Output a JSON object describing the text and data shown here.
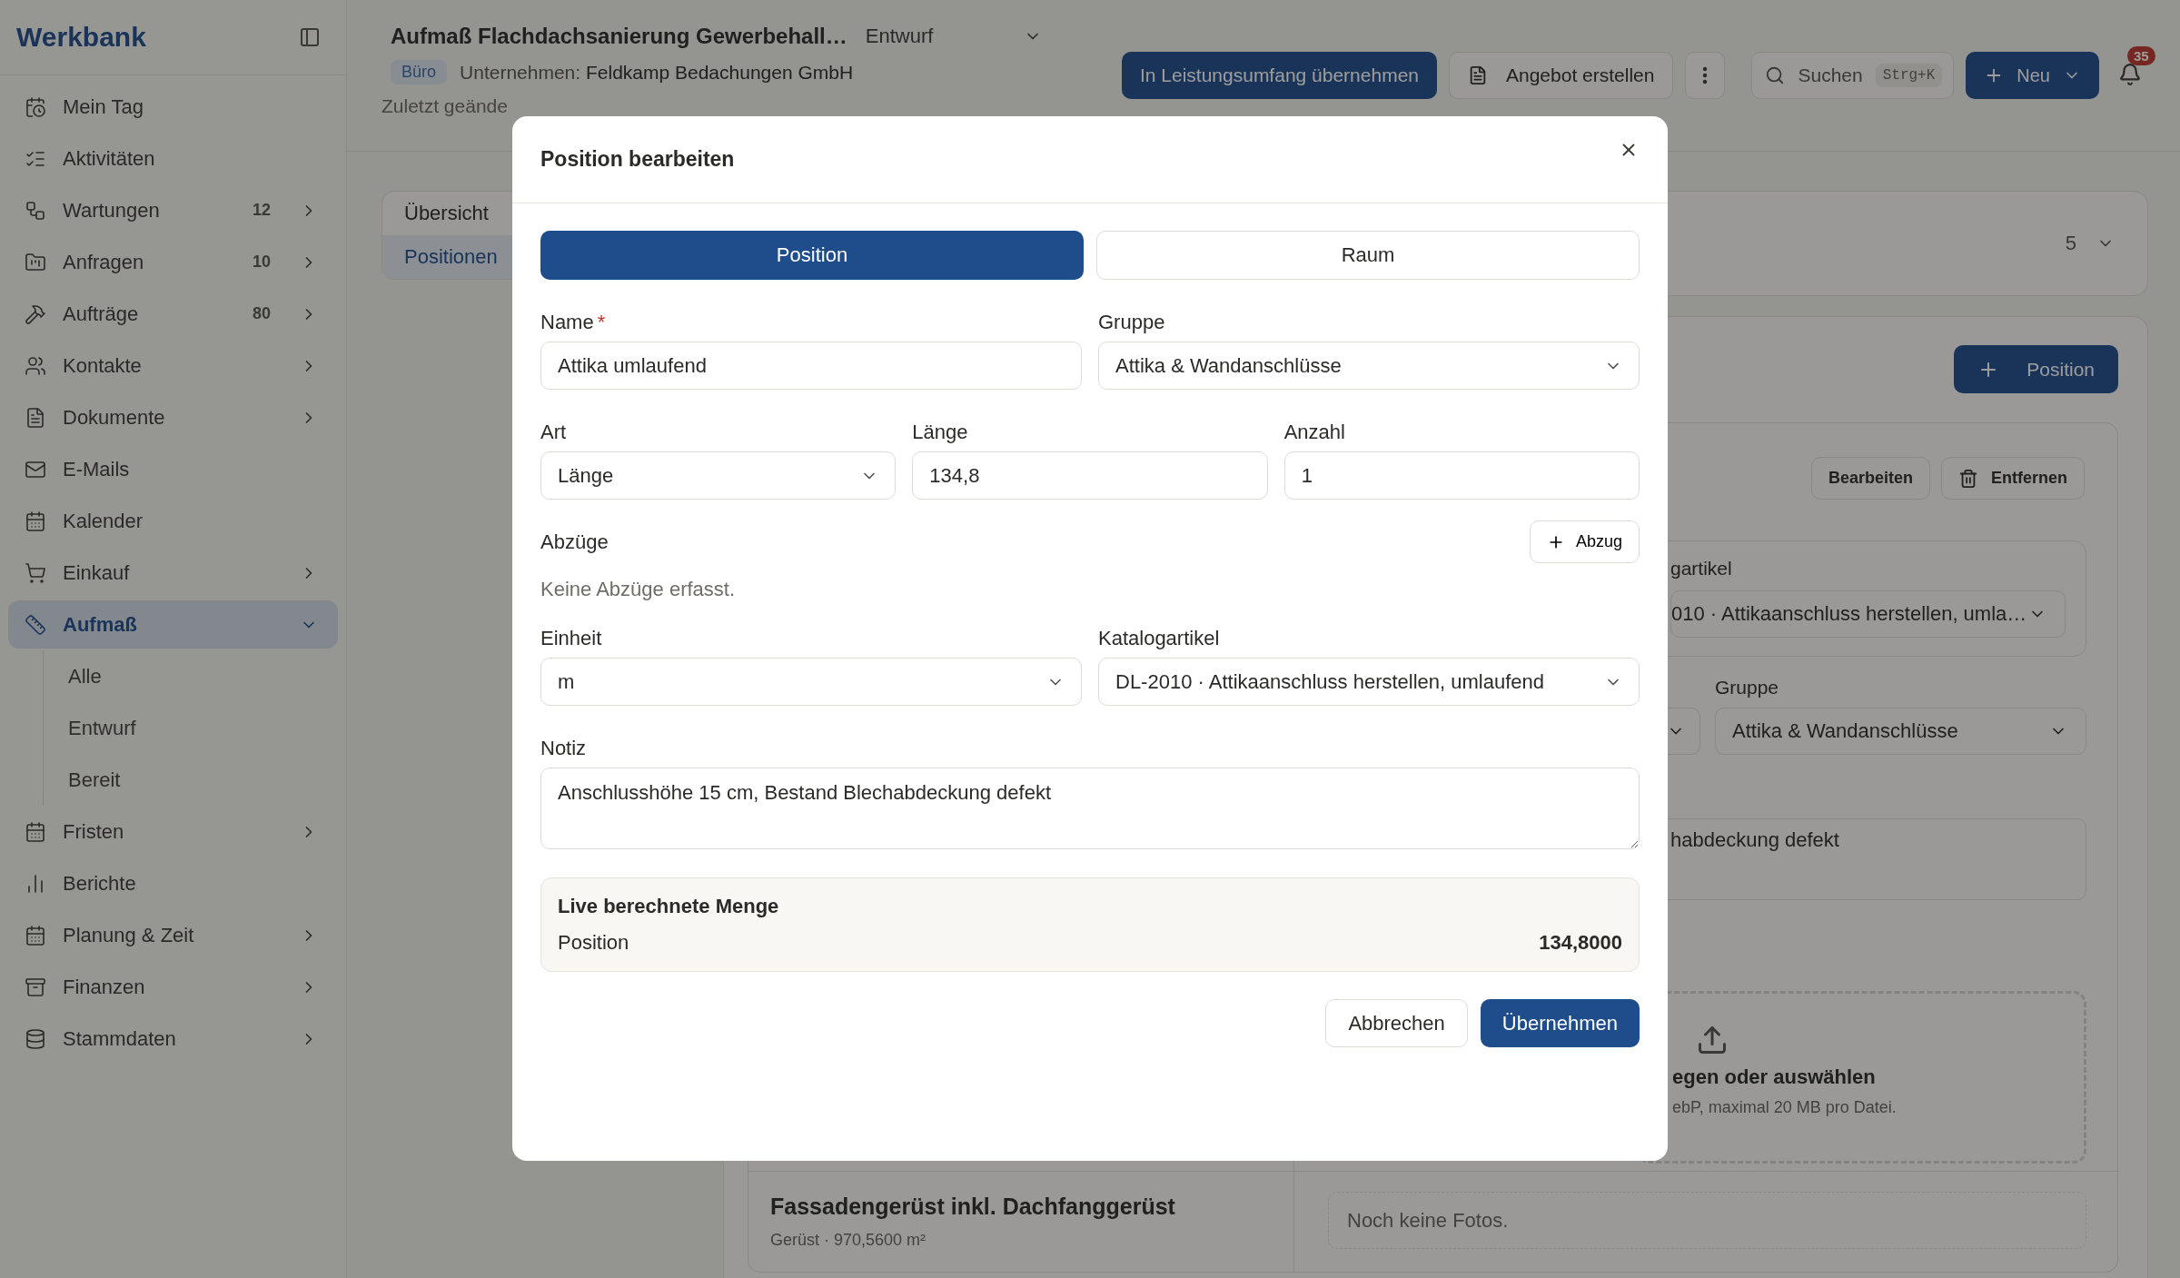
{
  "sidebar": {
    "logo": "Werkbank",
    "items": [
      {
        "label": "Mein Tag",
        "selected": false,
        "submenu": false
      },
      {
        "label": "Aktivitäten",
        "selected": false,
        "submenu": false
      },
      {
        "label": "Wartungen",
        "badge": "12",
        "selected": false,
        "submenu": true,
        "expanded": false
      },
      {
        "label": "Anfragen",
        "badge": "10",
        "selected": false,
        "submenu": true,
        "expanded": false
      },
      {
        "label": "Aufträge",
        "badge": "80",
        "selected": false,
        "submenu": true,
        "expanded": false
      },
      {
        "label": "Kontakte",
        "selected": false,
        "submenu": true,
        "expanded": false
      },
      {
        "label": "Dokumente",
        "selected": false,
        "submenu": true,
        "expanded": false
      },
      {
        "label": "E-Mails",
        "selected": false,
        "submenu": false
      },
      {
        "label": "Kalender",
        "selected": false,
        "submenu": false
      },
      {
        "label": "Einkauf",
        "selected": false,
        "submenu": true,
        "expanded": false
      },
      {
        "label": "Aufmaß",
        "selected": true,
        "submenu": true,
        "expanded": true,
        "children": [
          {
            "label": "Alle",
            "selected": false
          },
          {
            "label": "Entwurf",
            "selected": false
          },
          {
            "label": "Bereit",
            "selected": false
          }
        ]
      },
      {
        "label": "Fristen",
        "selected": false,
        "submenu": true,
        "expanded": false
      },
      {
        "label": "Berichte",
        "selected": false,
        "submenu": false
      },
      {
        "label": "Planung & Zeit",
        "selected": false,
        "submenu": true,
        "expanded": false
      },
      {
        "label": "Finanzen",
        "selected": false,
        "submenu": true,
        "expanded": false
      },
      {
        "label": "Stammdaten",
        "selected": false,
        "submenu": true,
        "expanded": false
      }
    ]
  },
  "header": {
    "title": "Aufmaß Flachdachsanierung Gewerbehall…",
    "status": "Entwurf",
    "tag": "Büro",
    "company": "Unternehmen: **Feldkamp Bedachungen GmbH**",
    "updated": "Zuletzt geände",
    "actions": [
      {
        "kind": "primary",
        "label": "In Leistungsumfang übernehmen"
      },
      {
        "kind": "document",
        "label": "Angebot erstellen"
      },
      {
        "kind": "more"
      }
    ],
    "search": {
      "label": "Suchen",
      "shortcut": "Strg+K"
    },
    "new_button": "Neu",
    "notifications": "35"
  },
  "background": {
    "tabs": [
      {
        "label": "Übersicht",
        "selected": false
      },
      {
        "label": "Positionen",
        "selected": true
      }
    ],
    "count": "5",
    "add_button": "Position",
    "item_actions": [
      "Bearbeiten",
      "Entfernen"
    ],
    "catalog_label": "gartikel",
    "catalog_value": "010 · Attikaanschluss herstellen, umla…",
    "group_label": "Gruppe",
    "group_value": "Attika & Wandanschlüsse",
    "note": "habdeckung defekt",
    "upload_title": "egen oder auswählen",
    "upload_hint": "ebP, maximal 20 MB pro Datei.",
    "positions": [
      {
        "title": "Fassadengerüst inkl. Dachfanggerüst",
        "meta": "Gerüst · 970,5600 m²",
        "photos": "Noch keine Fotos."
      }
    ]
  },
  "modal": {
    "title": "Position bearbeiten",
    "tabs": [
      {
        "label": "Position",
        "selected": true
      },
      {
        "label": "Raum",
        "selected": false
      }
    ],
    "fields": {
      "name": {
        "kind": "text",
        "label": "Name",
        "required_mark": "*",
        "value": "Attika umlaufend"
      },
      "group": {
        "kind": "select",
        "label": "Gruppe",
        "value": "Attika & Wandanschlüsse"
      },
      "type": {
        "kind": "select",
        "label": "Art",
        "value": "Länge"
      },
      "length": {
        "kind": "text",
        "label": "Länge",
        "value": "134,8"
      },
      "count": {
        "kind": "text",
        "label": "Anzahl",
        "value": "1"
      },
      "unit": {
        "kind": "select",
        "label": "Einheit",
        "value": "m"
      },
      "catalog": {
        "kind": "select",
        "label": "Katalogartikel",
        "value": "DL-2010 · Attikaanschluss herstellen, umlaufend"
      },
      "note": {
        "kind": "textarea",
        "label": "Notiz",
        "value": "Anschlusshöhe 15 cm, Bestand Blechabdeckung defekt"
      }
    },
    "deductions": {
      "label": "Abzüge",
      "add_button": "Abzug",
      "empty": "Keine Abzüge erfasst."
    },
    "live": {
      "title": "Live berechnete Menge",
      "label": "Position",
      "value": "134,8000"
    },
    "cancel": "Abbrechen",
    "confirm": "Übernehmen"
  }
}
